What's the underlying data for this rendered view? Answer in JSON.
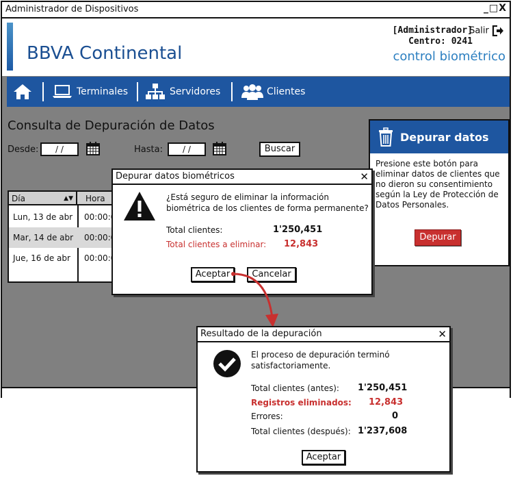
{
  "window": {
    "title": "Administrador de Dispositivos",
    "controls": "_□X"
  },
  "header": {
    "brand": "BBVA Continental",
    "user_role": "[Administrador]",
    "center": "Centro: 0241",
    "logout_label": "Salir",
    "subtitle": "control biométrico"
  },
  "nav": {
    "items": [
      {
        "label": "",
        "icon": "home-icon"
      },
      {
        "label": "Terminales",
        "icon": "laptop-icon"
      },
      {
        "label": "Servidores",
        "icon": "sitemap-icon"
      },
      {
        "label": "Clientes",
        "icon": "users-icon"
      }
    ]
  },
  "page": {
    "title": "Consulta de Depuración de Datos",
    "from_label": "Desde:",
    "from_value": "/ /",
    "to_label": "Hasta:",
    "to_value": "/ /",
    "search_label": "Buscar"
  },
  "table": {
    "headers": [
      "Día",
      "Hora"
    ],
    "rows": [
      [
        "Lun, 13 de abr",
        "00:00:0"
      ],
      [
        "Mar, 14 de abr",
        "00:00:0"
      ],
      [
        "Jue, 16 de abr",
        "00:00:0"
      ]
    ]
  },
  "purge_card": {
    "title": "Depurar datos",
    "description": "Presione este botón para eliminar datos de clientes que no dieron su consentimiento según la Ley de Protección de Datos Personales.",
    "button_label": "Depurar"
  },
  "confirm_dialog": {
    "title": "Depurar datos biométricos",
    "question": "¿Está seguro de eliminar la información biométrica de los clientes de forma permanente?",
    "total_label": "Total clientes:",
    "total_value": "1'250,451",
    "delete_label": "Total clientes a eliminar:",
    "delete_value": "12,843",
    "accept_label": "Aceptar",
    "cancel_label": "Cancelar"
  },
  "result_dialog": {
    "title": "Resultado de la depuración",
    "message": "El proceso de depuración terminó satisfactoriamente.",
    "before_label": "Total clientes (antes):",
    "before_value": "1'250,451",
    "deleted_label": "Registros eliminados:",
    "deleted_value": "12,843",
    "errors_label": "Errores:",
    "errors_value": "0",
    "after_label": "Total clientes (después):",
    "after_value": "1'237,608",
    "accept_label": "Aceptar"
  },
  "colors": {
    "brand_blue": "#1e56a0",
    "danger_red": "#c8302f",
    "backdrop_gray": "#808080"
  }
}
